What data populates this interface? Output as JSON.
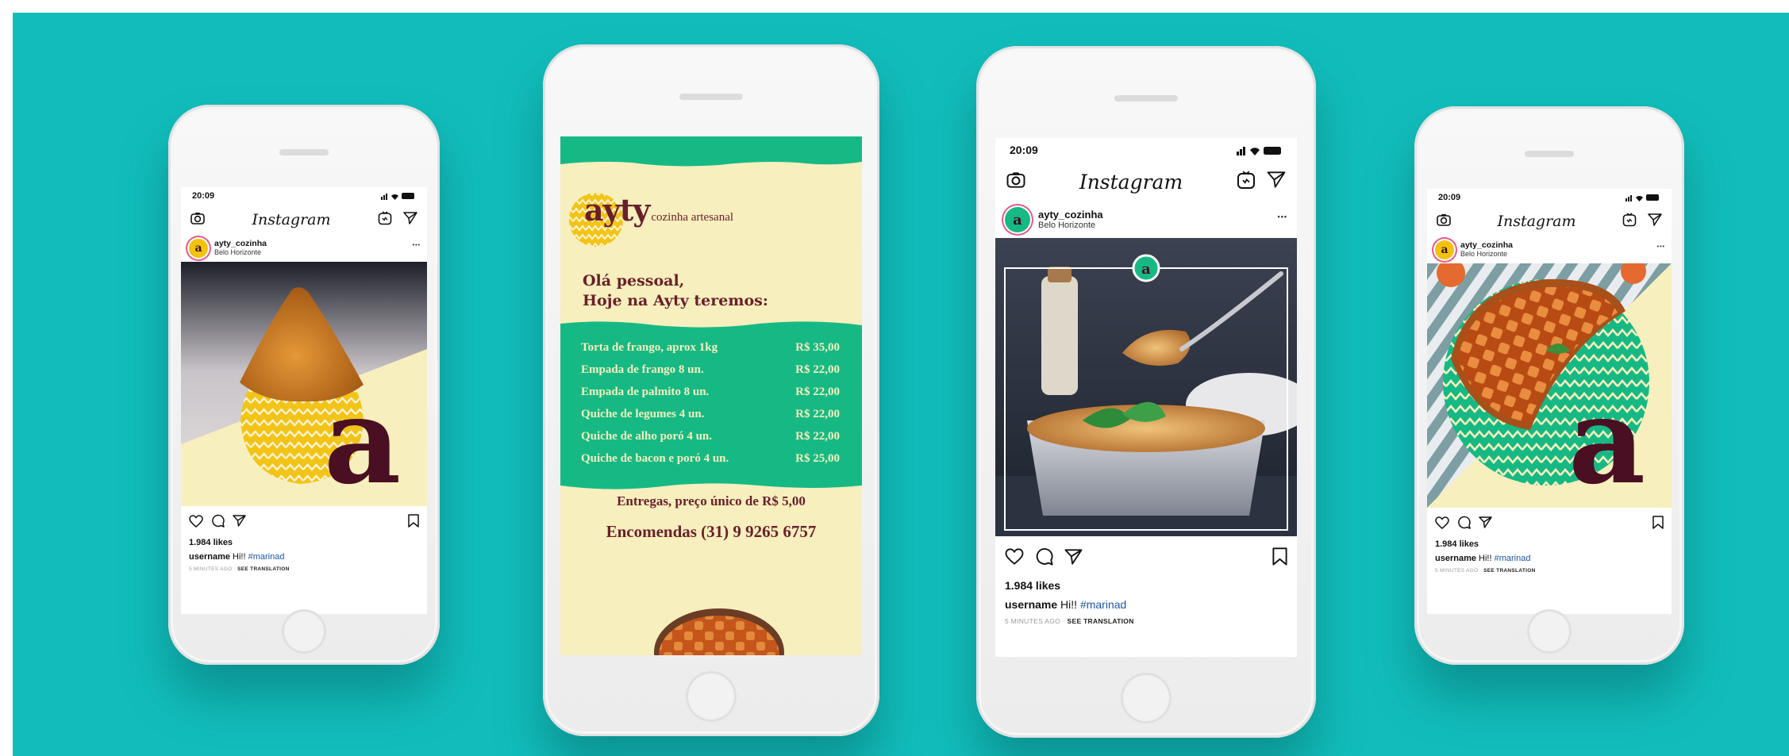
{
  "instagram": {
    "time": "20:09",
    "app_name": "Instagram",
    "username": "ayty_cozinha",
    "location": "Belo Horizonte",
    "likes": "1.984 likes",
    "caption_user": "username",
    "caption_text": "Hi!!",
    "caption_tag": "#marinad",
    "time_ago": "5 MINUTES AGO",
    "see_translation": "SEE TRANSLATION",
    "more": "•••"
  },
  "brand": {
    "avatar_letter": "a",
    "big_letter": "a",
    "logo_word": "ayty",
    "logo_tagline": "cozinha artesanal"
  },
  "menu_story": {
    "greeting_line1": "Olá pessoal,",
    "greeting_line2": "Hoje na Ayty teremos:",
    "items": [
      {
        "name": "Torta de frango, aprox 1kg",
        "price": "R$ 35,00"
      },
      {
        "name": "Empada de frango 8 un.",
        "price": "R$ 22,00"
      },
      {
        "name": "Empada de palmito 8 un.",
        "price": "R$ 22,00"
      },
      {
        "name": "Quiche de legumes 4 un.",
        "price": "R$ 22,00"
      },
      {
        "name": "Quiche de alho poró 4 un.",
        "price": "R$ 22,00"
      },
      {
        "name": "Quiche de bacon e poró 4 un.",
        "price": "R$ 25,00"
      }
    ],
    "delivery": "Entregas, preço único de R$ 5,00",
    "orders": "Encomendas (31) 9 9265 6757"
  },
  "colors": {
    "background": "#11bdbb",
    "cream": "#f7efbd",
    "green": "#16b984",
    "yellow": "#f2c417",
    "wine": "#4a0f22",
    "menu_title": "#6a1f2b"
  }
}
